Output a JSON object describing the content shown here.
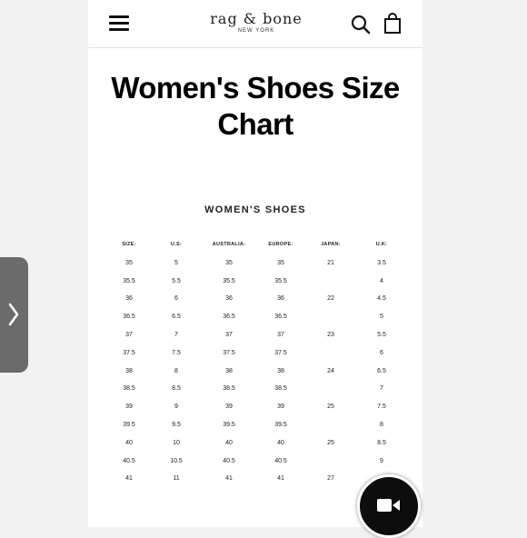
{
  "header": {
    "brand_name": "rag & bone",
    "brand_sub": "NEW YORK",
    "menu_icon": "hamburger-menu-icon",
    "search_icon": "search-icon",
    "bag_icon": "shopping-bag-icon"
  },
  "page": {
    "title_line1": "Women's Shoes Size",
    "title_line2": "Chart"
  },
  "size_table": {
    "heading": "WOMEN'S SHOES",
    "columns": [
      "SIZE:",
      "U.S:",
      "AUSTRALIA:",
      "EUROPE:",
      "JAPAN:",
      "U.K:"
    ],
    "rows": [
      [
        "35",
        "5",
        "35",
        "35",
        "21",
        "3.5"
      ],
      [
        "35.5",
        "5.5",
        "35.5",
        "35.5",
        "",
        "4"
      ],
      [
        "36",
        "6",
        "36",
        "36",
        "22",
        "4.5"
      ],
      [
        "36.5",
        "6.5",
        "36.5",
        "36.5",
        "",
        "5"
      ],
      [
        "37",
        "7",
        "37",
        "37",
        "23",
        "5.5"
      ],
      [
        "37.5",
        "7.5",
        "37.5",
        "37.5",
        "",
        "6"
      ],
      [
        "38",
        "8",
        "38",
        "38",
        "24",
        "6.5"
      ],
      [
        "38.5",
        "8.5",
        "38.5",
        "38.5",
        "",
        "7"
      ],
      [
        "39",
        "9",
        "39",
        "39",
        "25",
        "7.5"
      ],
      [
        "39.5",
        "9.5",
        "39.5",
        "39.5",
        "",
        "8"
      ],
      [
        "40",
        "10",
        "40",
        "40",
        "25",
        "8.5"
      ],
      [
        "40.5",
        "10.5",
        "40.5",
        "40.5",
        "",
        "9"
      ],
      [
        "41",
        "11",
        "41",
        "41",
        "27",
        ""
      ]
    ]
  },
  "overlay": {
    "side_tab_icon": "chevron-right-icon",
    "chat_icon": "video-camera-icon"
  },
  "colors": {
    "background": "#f2f2f2",
    "page": "#ffffff",
    "text": "#111111",
    "side_tab": "#6b6b6b",
    "chat_button": "#0d0d0d"
  }
}
